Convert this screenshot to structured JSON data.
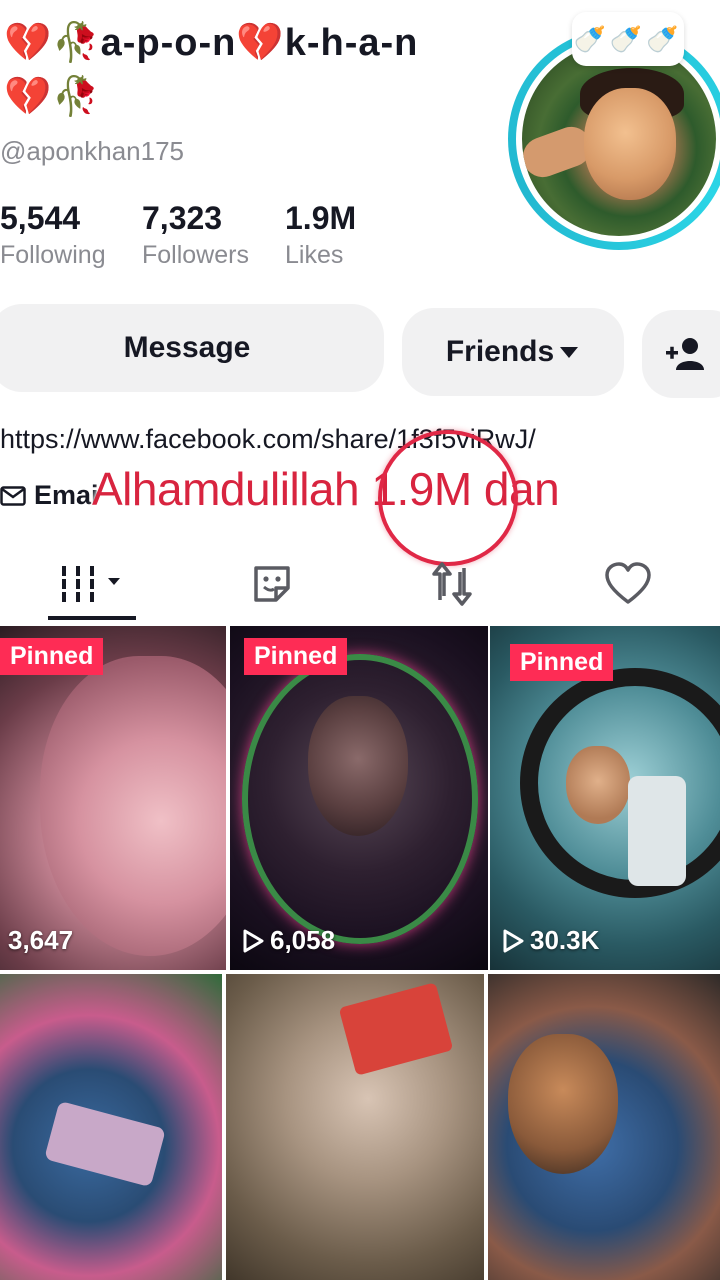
{
  "profile": {
    "name_line1": "a-p-o-n",
    "name_line1_suffix": "k-h-a-n",
    "emoji_broken_heart": "💔",
    "emoji_rose": "🥀",
    "handle": "@aponkhan175",
    "avatar_badge": "🍼🍼🍼"
  },
  "stats": {
    "following": {
      "value": "5,544",
      "label": "Following"
    },
    "followers": {
      "value": "7,323",
      "label": "Followers"
    },
    "likes": {
      "value": "1.9M",
      "label": "Likes"
    }
  },
  "actions": {
    "message": "Message",
    "friends": "Friends",
    "add_user_icon": "add-user-icon"
  },
  "bio": {
    "link": "https://www.facebook.com/share/1f3f5viRwJ/",
    "email_label": "Emai"
  },
  "overlay": {
    "text": "Alhamdulillah 1.9M dan",
    "color": "#d8243f"
  },
  "tabs": [
    {
      "name": "videos",
      "icon": "grid-icon"
    },
    {
      "name": "collection",
      "icon": "sticker-icon"
    },
    {
      "name": "reposts",
      "icon": "repost-icon"
    },
    {
      "name": "liked",
      "icon": "heart-icon"
    }
  ],
  "videos": [
    {
      "pinned": "Pinned",
      "views": "3,647"
    },
    {
      "pinned": "Pinned",
      "views": "6,058"
    },
    {
      "pinned": "Pinned",
      "views": "30.3K"
    },
    {
      "pinned": "",
      "views": ""
    },
    {
      "pinned": "",
      "views": ""
    },
    {
      "pinned": "",
      "views": ""
    }
  ],
  "colors": {
    "accent": "#fe2c55",
    "avatar_ring": "#25c4d9"
  }
}
